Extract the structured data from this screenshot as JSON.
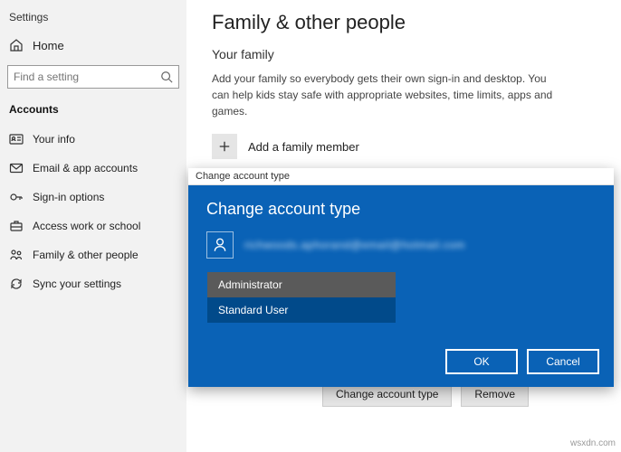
{
  "window_title": "Settings",
  "sidebar": {
    "home": "Home",
    "search_placeholder": "Find a setting",
    "section": "Accounts",
    "items": [
      {
        "label": "Your info"
      },
      {
        "label": "Email & app accounts"
      },
      {
        "label": "Sign-in options"
      },
      {
        "label": "Access work or school"
      },
      {
        "label": "Family & other people"
      },
      {
        "label": "Sync your settings"
      }
    ]
  },
  "main": {
    "title": "Family & other people",
    "family_heading": "Your family",
    "family_body": "Add your family so everybody gets their own sign-in and desktop. You can help kids stay safe with appropriate websites, time limits, apps and games.",
    "add_member_label": "Add a family member",
    "change_type_btn": "Change account type",
    "remove_btn": "Remove"
  },
  "dialog": {
    "titlebar": "Change account type",
    "heading": "Change account type",
    "email": "richwoods.aphorand@email@hotmail.com",
    "options": [
      {
        "label": "Administrator",
        "selected": true
      },
      {
        "label": "Standard User",
        "selected": false
      }
    ],
    "ok": "OK",
    "cancel": "Cancel"
  },
  "watermark": "wsxdn.com"
}
